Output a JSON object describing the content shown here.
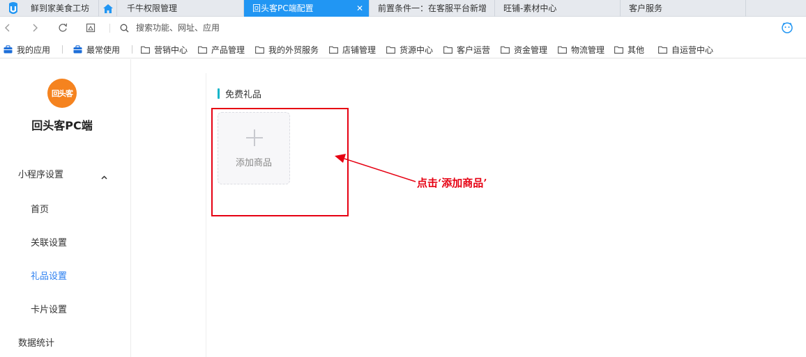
{
  "tabs": [
    {
      "label": "鲜到家美食工坊"
    },
    {
      "label": "千牛权限管理"
    },
    {
      "label": "回头客PC端配置",
      "close": "✕"
    },
    {
      "label": "前置条件一：在客服平台新增"
    },
    {
      "label": "旺铺-素材中心"
    },
    {
      "label": "客户服务"
    }
  ],
  "address": {
    "placeholder": "搜索功能、网址、应用"
  },
  "bookmarks": [
    {
      "label": "我的应用"
    },
    {
      "label": "最常使用"
    },
    {
      "label": "营销中心"
    },
    {
      "label": "产品管理"
    },
    {
      "label": "我的外贸服务"
    },
    {
      "label": "店铺管理"
    },
    {
      "label": "货源中心"
    },
    {
      "label": "客户运营"
    },
    {
      "label": "资金管理"
    },
    {
      "label": "物流管理"
    },
    {
      "label": "其他"
    },
    {
      "label": "自运营中心"
    }
  ],
  "sidebar": {
    "logo_text": "回头客",
    "app_name": "回头客PC端",
    "group": {
      "label": "小程序设置",
      "caret": "˄"
    },
    "items": [
      {
        "label": "首页"
      },
      {
        "label": "关联设置"
      },
      {
        "label": "礼品设置"
      },
      {
        "label": "卡片设置"
      }
    ],
    "stats": "数据统计"
  },
  "content": {
    "section_title": "免费礼品",
    "add_card_label": "添加商品",
    "annotation": "点击‘添加商品’"
  },
  "colors": {
    "tab_active": "#2196f3",
    "menu_active": "#2b7ff0",
    "section_bar": "#16b5c9",
    "annotation": "#e60012",
    "logo_bg": "#f5831f"
  }
}
